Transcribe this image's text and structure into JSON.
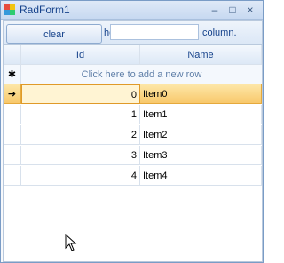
{
  "window": {
    "title": "RadForm1",
    "minimize": "–",
    "maximize": "□",
    "close": "×"
  },
  "toolbar": {
    "clear_label": "clear",
    "hint_left": "he",
    "hint_right": "column.",
    "search_value": "",
    "search_placeholder": ""
  },
  "grid": {
    "columns": [
      "Id",
      "Name"
    ],
    "new_row_marker": "✱",
    "new_row_text": "Click here to add a new row",
    "current_row_marker": "➔",
    "rows": [
      {
        "id": "0",
        "name": "Item0"
      },
      {
        "id": "1",
        "name": "Item1"
      },
      {
        "id": "2",
        "name": "Item2"
      },
      {
        "id": "3",
        "name": "Item3"
      },
      {
        "id": "4",
        "name": "Item4"
      }
    ]
  }
}
